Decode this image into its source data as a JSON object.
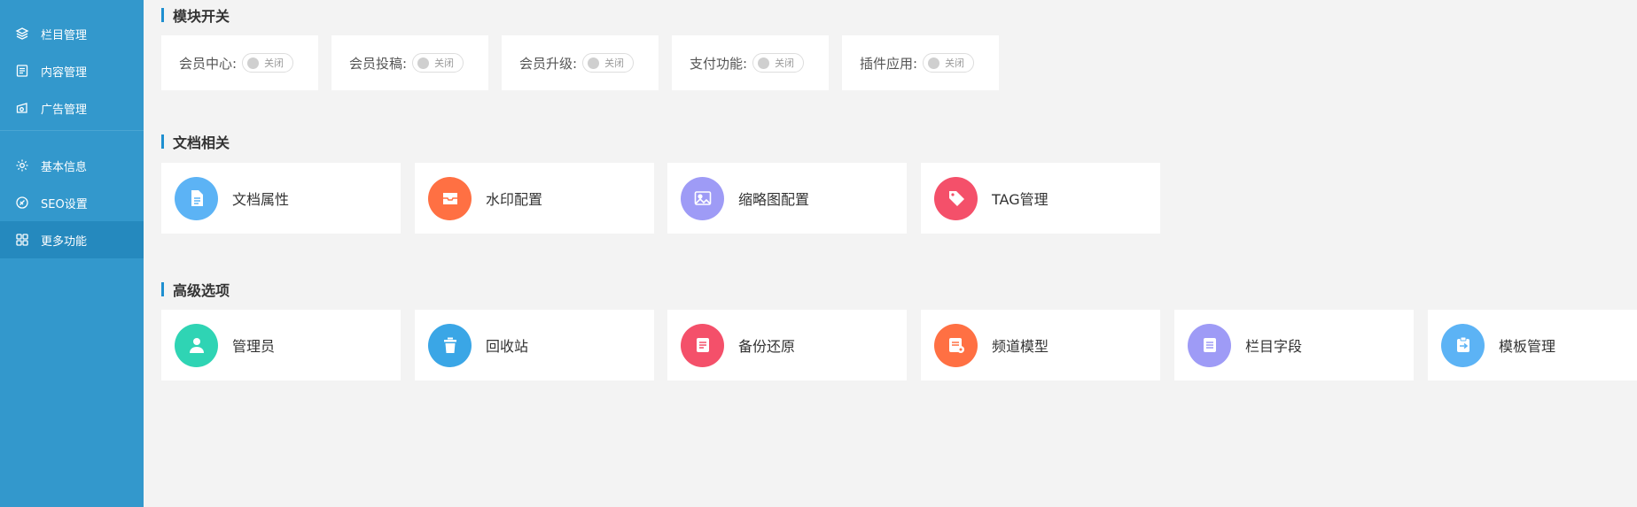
{
  "sidebar": {
    "items": [
      {
        "label": "栏目管理",
        "icon": "layers-icon"
      },
      {
        "label": "内容管理",
        "icon": "document-icon"
      },
      {
        "label": "广告管理",
        "icon": "ad-icon"
      },
      {
        "label": "基本信息",
        "icon": "gear-icon"
      },
      {
        "label": "SEO设置",
        "icon": "seo-icon"
      },
      {
        "label": "更多功能",
        "icon": "grid-icon",
        "active": true
      }
    ]
  },
  "sections": {
    "modules": {
      "title": "模块开关",
      "switches": [
        {
          "label": "会员中心:",
          "state": "关闭"
        },
        {
          "label": "会员投稿:",
          "state": "关闭"
        },
        {
          "label": "会员升级:",
          "state": "关闭"
        },
        {
          "label": "支付功能:",
          "state": "关闭"
        },
        {
          "label": "插件应用:",
          "state": "关闭"
        }
      ]
    },
    "docs": {
      "title": "文档相关",
      "tiles": [
        {
          "label": "文档属性",
          "icon": "file-icon",
          "color": "#5cb3f5"
        },
        {
          "label": "水印配置",
          "icon": "inbox-icon",
          "color": "#ff7043"
        },
        {
          "label": "缩略图配置",
          "icon": "image-icon",
          "color": "#9e9bf6"
        },
        {
          "label": "TAG管理",
          "icon": "tag-icon",
          "color": "#f4506a"
        }
      ]
    },
    "advanced": {
      "title": "高级选项",
      "tiles": [
        {
          "label": "管理员",
          "icon": "admin-icon",
          "color": "#2fd4b4"
        },
        {
          "label": "回收站",
          "icon": "trash-icon",
          "color": "#3aa6e6"
        },
        {
          "label": "备份还原",
          "icon": "backup-icon",
          "color": "#f4506a"
        },
        {
          "label": "频道模型",
          "icon": "model-icon",
          "color": "#ff7043"
        },
        {
          "label": "栏目字段",
          "icon": "list-icon",
          "color": "#9e9bf6"
        },
        {
          "label": "模板管理",
          "icon": "clipboard-icon",
          "color": "#5cb3f5"
        }
      ]
    }
  }
}
